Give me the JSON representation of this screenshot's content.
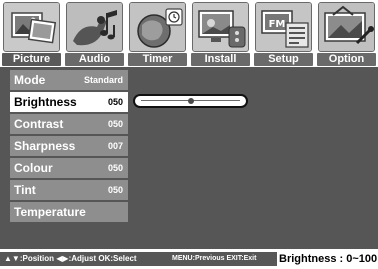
{
  "tabs": [
    {
      "label": "Picture",
      "icon": "picture-icon",
      "active": true
    },
    {
      "label": "Audio",
      "icon": "audio-icon",
      "active": false
    },
    {
      "label": "Timer",
      "icon": "timer-icon",
      "active": false
    },
    {
      "label": "Install",
      "icon": "install-icon",
      "active": false
    },
    {
      "label": "Setup",
      "icon": "setup-icon",
      "active": false
    },
    {
      "label": "Option",
      "icon": "option-icon",
      "active": false
    }
  ],
  "menu": {
    "items": [
      {
        "label": "Mode",
        "value": "Standard",
        "selected": false
      },
      {
        "label": "Brightness",
        "value": "050",
        "selected": true
      },
      {
        "label": "Contrast",
        "value": "050",
        "selected": false
      },
      {
        "label": "Sharpness",
        "value": "007",
        "selected": false
      },
      {
        "label": "Colour",
        "value": "050",
        "selected": false
      },
      {
        "label": "Tint",
        "value": "050",
        "selected": false
      },
      {
        "label": "Temperature",
        "value": "",
        "selected": false
      }
    ]
  },
  "slider": {
    "level_percent": 50,
    "min": 0,
    "max": 100
  },
  "help": {
    "nav": "▲▼:Position ◀▶:Adjust OK:Select",
    "menu_exit": "MENU:Previous  EXIT:Exit",
    "info": "Brightness : 0~100"
  },
  "colors": {
    "background": "#565656",
    "menu_row": "#8e8e8e",
    "selected_row": "#ffffff",
    "tab_label": "#6a6a6a"
  }
}
